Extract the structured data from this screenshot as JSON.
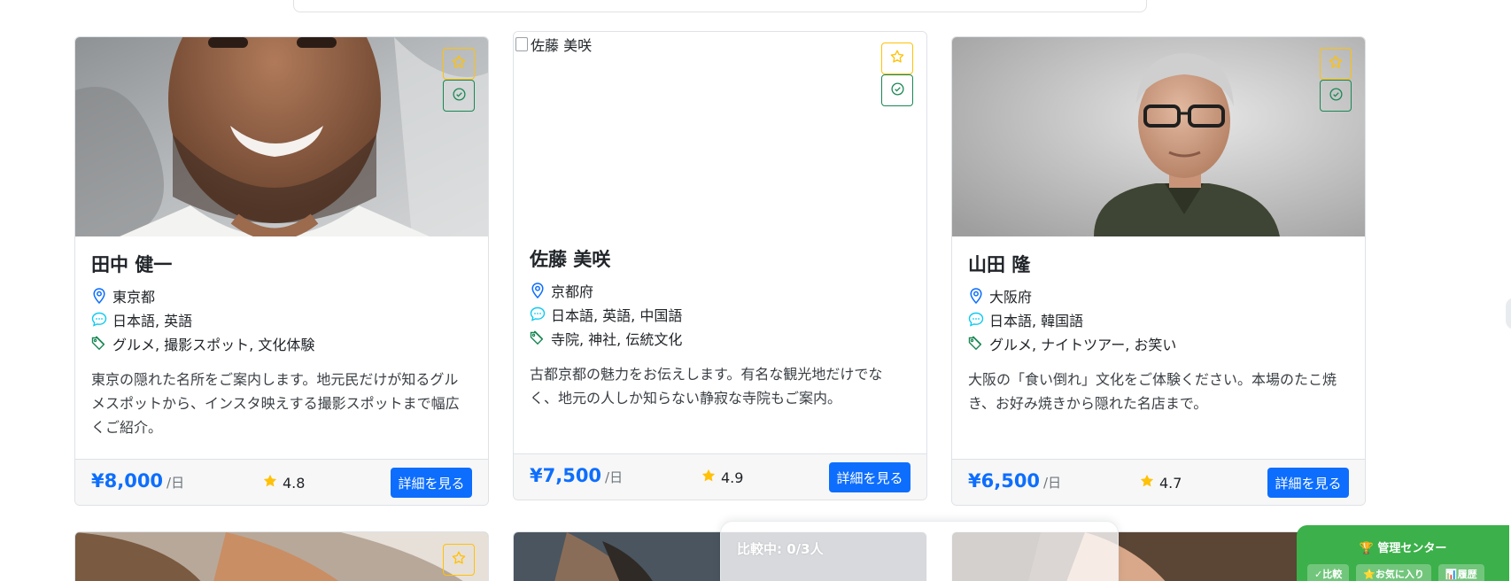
{
  "colors": {
    "primary": "#0d6efd",
    "favorite": "#ffc107",
    "compare": "#198754",
    "admin": "#3cb04a",
    "location_icon": "#0d6efd",
    "language_icon": "#0dcaf0",
    "tag_icon": "#198754"
  },
  "guides": [
    {
      "name": "田中 健一",
      "location": "東京都",
      "languages": "日本語, 英語",
      "tags": "グルメ, 撮影スポット, 文化体験",
      "description": "東京の隠れた名所をご案内します。地元民だけが知るグルメスポットから、インスタ映えする撮影スポットまで幅広くご紹介。",
      "price": "¥8,000",
      "price_unit": "/日",
      "rating": "4.8",
      "detail_label": "詳細を見る",
      "photo": "man-smiling-photo"
    },
    {
      "name": "佐藤 美咲",
      "image_alt": "佐藤 美咲",
      "location": "京都府",
      "languages": "日本語, 英語, 中国語",
      "tags": "寺院, 神社, 伝統文化",
      "description": "古都京都の魅力をお伝えします。有名な観光地だけでなく、地元の人しか知らない静寂な寺院もご案内。",
      "price": "¥7,500",
      "price_unit": "/日",
      "rating": "4.9",
      "detail_label": "詳細を見る",
      "photo": "broken-image"
    },
    {
      "name": "山田 隆",
      "location": "大阪府",
      "languages": "日本語, 韓国語",
      "tags": "グルメ, ナイトツアー, お笑い",
      "description": "大阪の「食い倒れ」文化をご体験ください。本場のたこ焼き、お好み焼きから隠れた名店まで。",
      "price": "¥6,500",
      "price_unit": "/日",
      "rating": "4.7",
      "detail_label": "詳細を見る",
      "photo": "older-man-glasses-photo"
    }
  ],
  "compare_bar": {
    "label": "比較中: 0/3人"
  },
  "admin_panel": {
    "title": "🏆 管理センター",
    "tabs": [
      "✓比較",
      "⭐お気に入り",
      "📊履歴"
    ]
  }
}
